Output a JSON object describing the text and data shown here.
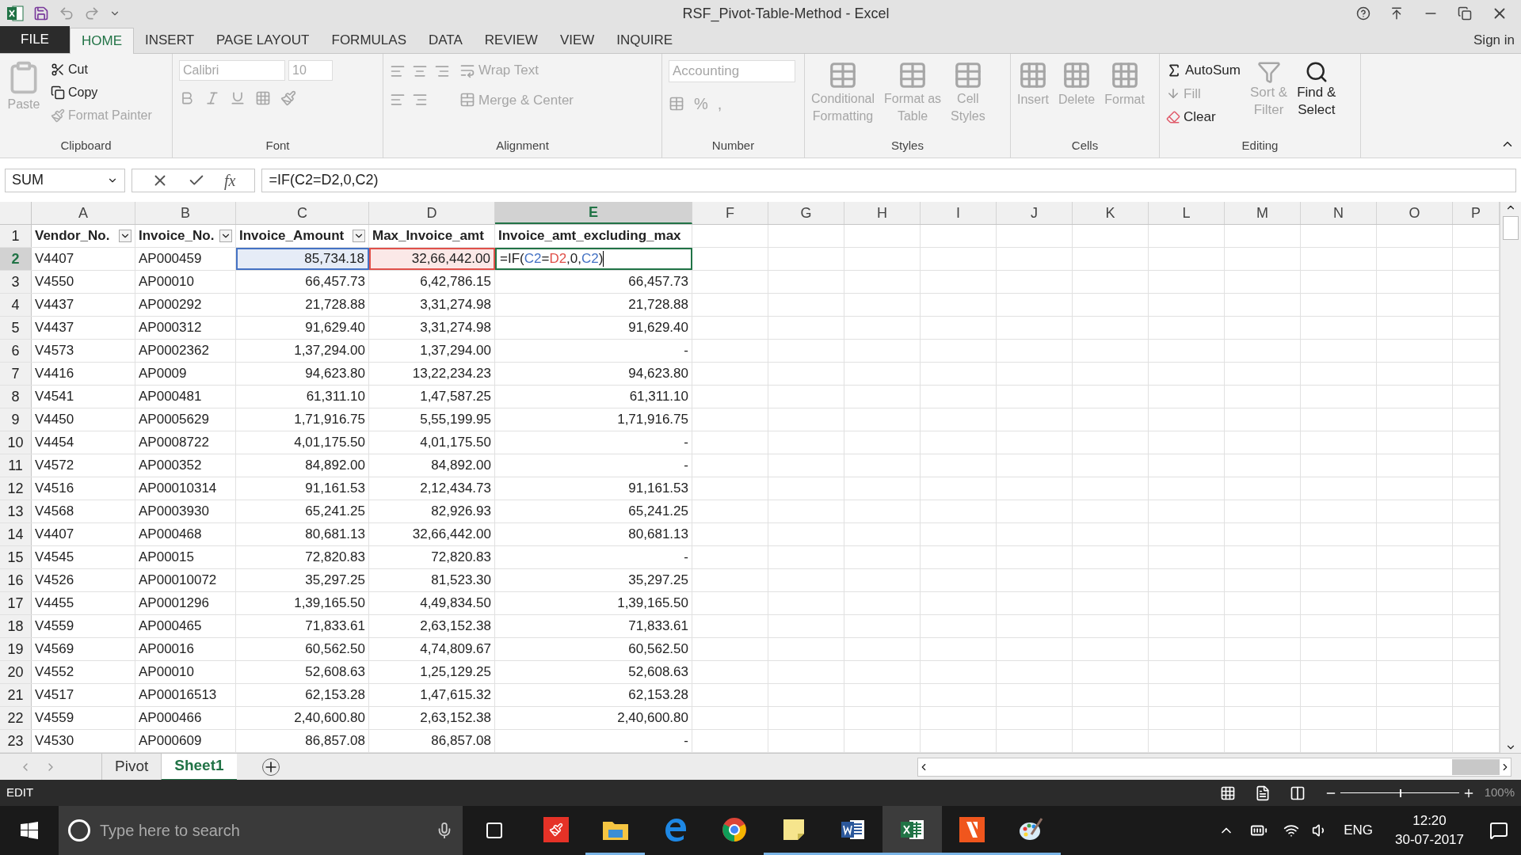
{
  "window": {
    "title": "RSF_Pivot-Table-Method - Excel",
    "sign_in": "Sign in"
  },
  "menu_tabs": [
    {
      "label": "FILE",
      "kind": "file",
      "selected": false
    },
    {
      "label": "HOME",
      "kind": "tab",
      "selected": true
    },
    {
      "label": "INSERT",
      "kind": "tab",
      "selected": false
    },
    {
      "label": "PAGE LAYOUT",
      "kind": "tab",
      "selected": false
    },
    {
      "label": "FORMULAS",
      "kind": "tab",
      "selected": false
    },
    {
      "label": "DATA",
      "kind": "tab",
      "selected": false
    },
    {
      "label": "REVIEW",
      "kind": "tab",
      "selected": false
    },
    {
      "label": "VIEW",
      "kind": "tab",
      "selected": false
    },
    {
      "label": "INQUIRE",
      "kind": "tab",
      "selected": false
    }
  ],
  "ribbon": {
    "clipboard": {
      "label": "Clipboard",
      "paste": {
        "label": "Paste",
        "disabled": true
      },
      "cut": {
        "label": "Cut",
        "disabled": false
      },
      "copy": {
        "label": "Copy",
        "disabled": false
      },
      "format_painter": {
        "label": "Format Painter",
        "disabled": true
      }
    },
    "font": {
      "label": "Font",
      "font_name": "Calibri",
      "font_size": "10",
      "disabled": true
    },
    "alignment": {
      "label": "Alignment",
      "wrap_text": "Wrap Text",
      "merge": "Merge & Center",
      "disabled": true
    },
    "number": {
      "label": "Number",
      "format": "Accounting",
      "percent": "%",
      "comma": ",",
      "disabled": true
    },
    "styles": {
      "label": "Styles",
      "items": [
        "Conditional\nFormatting",
        "Format as\nTable",
        "Cell\nStyles"
      ],
      "disabled": true
    },
    "cells": {
      "label": "Cells",
      "items": [
        "Insert",
        "Delete",
        "Format"
      ],
      "disabled": true
    },
    "editing": {
      "label": "Editing",
      "autosum": {
        "label": "AutoSum",
        "disabled": false
      },
      "fill": {
        "label": "Fill",
        "disabled": true
      },
      "clear": {
        "label": "Clear",
        "disabled": false
      },
      "sort": {
        "label": "Sort &\nFilter",
        "disabled": true
      },
      "find": {
        "label": "Find &\nSelect",
        "disabled": false
      }
    }
  },
  "formula_bar": {
    "name_box": "SUM",
    "insert_function": "fx",
    "formula": "=IF(C2=D2,0,C2)"
  },
  "columns": [
    {
      "label": "A",
      "selected": false
    },
    {
      "label": "B",
      "selected": false
    },
    {
      "label": "C",
      "selected": false
    },
    {
      "label": "D",
      "selected": false
    },
    {
      "label": "E",
      "selected": true
    },
    {
      "label": "F",
      "selected": false
    },
    {
      "label": "G",
      "selected": false
    },
    {
      "label": "H",
      "selected": false
    },
    {
      "label": "I",
      "selected": false
    },
    {
      "label": "J",
      "selected": false
    },
    {
      "label": "K",
      "selected": false
    },
    {
      "label": "L",
      "selected": false
    },
    {
      "label": "M",
      "selected": false
    },
    {
      "label": "N",
      "selected": false
    },
    {
      "label": "O",
      "selected": false
    },
    {
      "label": "P",
      "selected": false
    }
  ],
  "header_row": {
    "number": "1",
    "cells": [
      {
        "text": "Vendor_No.",
        "filter": true
      },
      {
        "text": "Invoice_No.",
        "filter": true
      },
      {
        "text": "Invoice_Amount",
        "filter": true
      },
      {
        "text": "Max_Invoice_amt",
        "filter": false
      },
      {
        "text": "Invoice_amt_excluding_max",
        "filter": false
      }
    ]
  },
  "rows": [
    {
      "number": "2",
      "selected": true,
      "cells": [
        {
          "text": "V4407"
        },
        {
          "text": "AP000459"
        },
        {
          "text": "85,734.18",
          "color": "#4472c4"
        },
        {
          "text": "32,66,442.00",
          "color": "#e0504a"
        }
      ],
      "editing": [
        {
          "text": "=IF("
        },
        {
          "text": "C2",
          "color": "#4472c4"
        },
        {
          "text": "="
        },
        {
          "text": "D2",
          "color": "#e0504a"
        },
        {
          "text": ",0,"
        },
        {
          "text": "C2",
          "color": "#4472c4"
        },
        {
          "text": ")"
        }
      ]
    },
    {
      "number": "3",
      "selected": false,
      "cells": [
        "V4550",
        "AP00010",
        "66,457.73",
        "6,42,786.15",
        "66,457.73"
      ]
    },
    {
      "number": "4",
      "selected": false,
      "cells": [
        "V4437",
        "AP000292",
        "21,728.88",
        "3,31,274.98",
        "21,728.88"
      ]
    },
    {
      "number": "5",
      "selected": false,
      "cells": [
        "V4437",
        "AP000312",
        "91,629.40",
        "3,31,274.98",
        "91,629.40"
      ]
    },
    {
      "number": "6",
      "selected": false,
      "cells": [
        "V4573",
        "AP0002362",
        "1,37,294.00",
        "1,37,294.00",
        "-"
      ]
    },
    {
      "number": "7",
      "selected": false,
      "cells": [
        "V4416",
        "AP0009",
        "94,623.80",
        "13,22,234.23",
        "94,623.80"
      ]
    },
    {
      "number": "8",
      "selected": false,
      "cells": [
        "V4541",
        "AP000481",
        "61,311.10",
        "1,47,587.25",
        "61,311.10"
      ]
    },
    {
      "number": "9",
      "selected": false,
      "cells": [
        "V4450",
        "AP0005629",
        "1,71,916.75",
        "5,55,199.95",
        "1,71,916.75"
      ]
    },
    {
      "number": "10",
      "selected": false,
      "cells": [
        "V4454",
        "AP0008722",
        "4,01,175.50",
        "4,01,175.50",
        "-"
      ]
    },
    {
      "number": "11",
      "selected": false,
      "cells": [
        "V4572",
        "AP000352",
        "84,892.00",
        "84,892.00",
        "-"
      ]
    },
    {
      "number": "12",
      "selected": false,
      "cells": [
        "V4516",
        "AP00010314",
        "91,161.53",
        "2,12,434.73",
        "91,161.53"
      ]
    },
    {
      "number": "13",
      "selected": false,
      "cells": [
        "V4568",
        "AP0003930",
        "65,241.25",
        "82,926.93",
        "65,241.25"
      ]
    },
    {
      "number": "14",
      "selected": false,
      "cells": [
        "V4407",
        "AP000468",
        "80,681.13",
        "32,66,442.00",
        "80,681.13"
      ]
    },
    {
      "number": "15",
      "selected": false,
      "cells": [
        "V4545",
        "AP00015",
        "72,820.83",
        "72,820.83",
        "-"
      ]
    },
    {
      "number": "16",
      "selected": false,
      "cells": [
        "V4526",
        "AP00010072",
        "35,297.25",
        "81,523.30",
        "35,297.25"
      ]
    },
    {
      "number": "17",
      "selected": false,
      "cells": [
        "V4455",
        "AP0001296",
        "1,39,165.50",
        "4,49,834.50",
        "1,39,165.50"
      ]
    },
    {
      "number": "18",
      "selected": false,
      "cells": [
        "V4559",
        "AP000465",
        "71,833.61",
        "2,63,152.38",
        "71,833.61"
      ]
    },
    {
      "number": "19",
      "selected": false,
      "cells": [
        "V4569",
        "AP00016",
        "60,562.50",
        "4,74,809.67",
        "60,562.50"
      ]
    },
    {
      "number": "20",
      "selected": false,
      "cells": [
        "V4552",
        "AP00010",
        "52,608.63",
        "1,25,129.25",
        "52,608.63"
      ]
    },
    {
      "number": "21",
      "selected": false,
      "cells": [
        "V4517",
        "AP00016513",
        "62,153.28",
        "1,47,615.32",
        "62,153.28"
      ]
    },
    {
      "number": "22",
      "selected": false,
      "cells": [
        "V4559",
        "AP000466",
        "2,40,600.80",
        "2,63,152.38",
        "2,40,600.80"
      ]
    },
    {
      "number": "23",
      "selected": false,
      "cells": [
        "V4530",
        "AP000609",
        "86,857.08",
        "86,857.08",
        "-"
      ]
    }
  ],
  "sheet_tabs": [
    {
      "label": "Pivot",
      "selected": false
    },
    {
      "label": "Sheet1",
      "selected": true
    }
  ],
  "status_bar": {
    "mode": "EDIT",
    "zoom": {
      "level": 0.5,
      "reading": "100%"
    }
  },
  "taskbar": {
    "search_placeholder": "Type here to search",
    "apps": [
      {
        "kind": "red-app",
        "open": false,
        "active": false
      },
      {
        "kind": "folder",
        "open": true,
        "active": false
      },
      {
        "kind": "edge",
        "open": false,
        "active": false
      },
      {
        "kind": "chrome",
        "open": false,
        "active": false
      },
      {
        "kind": "notes",
        "open": true,
        "active": false
      },
      {
        "kind": "word",
        "open": true,
        "active": false
      },
      {
        "kind": "excel",
        "open": true,
        "active": true
      },
      {
        "kind": "acrobat",
        "open": true,
        "active": false
      },
      {
        "kind": "paint",
        "open": true,
        "active": false
      }
    ],
    "language": "ENG",
    "time": "12:20",
    "date": "30-07-2017"
  }
}
